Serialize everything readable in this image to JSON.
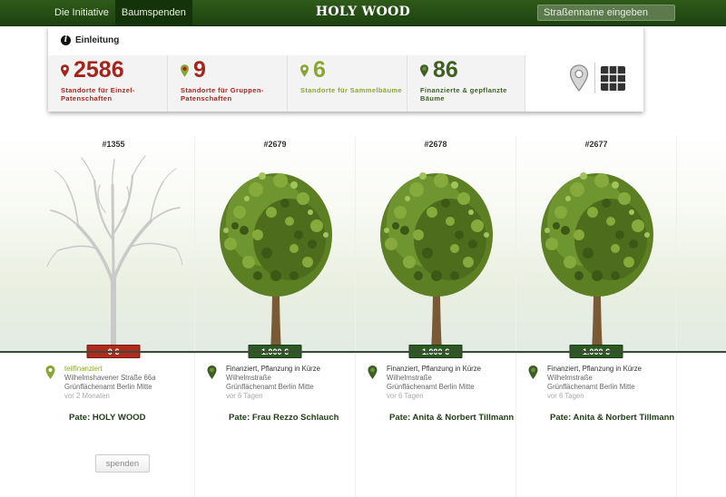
{
  "nav": {
    "items": [
      "Die Initiative",
      "Baumspenden"
    ],
    "active": 1
  },
  "logo": "HOLY WOOD",
  "search": {
    "placeholder": "Straßenname eingeben",
    "value": ""
  },
  "intro": {
    "title": "Einleitung",
    "stats": [
      {
        "value": "2586",
        "label": "Standorte für Einzel-Patenschaften",
        "color": "#a3261d"
      },
      {
        "value": "9",
        "label": "Standorte für Gruppen-Patenschaften",
        "color": "#a3261d"
      },
      {
        "value": "6",
        "label": "Standorte für Sammelbäume",
        "color": "#8aa632"
      },
      {
        "value": "86",
        "label": "Finanzierte & gepflanzte Bäume",
        "color": "#3e5e24"
      }
    ],
    "view_icons": [
      "map-pin-icon",
      "grid-icon"
    ]
  },
  "trees": [
    {
      "id": "#1355",
      "amount": "0 €",
      "status": "teilfinanziert",
      "street": "Wilhelmshavener Straße 66a",
      "office": "Grünflächenamt Berlin Mitte",
      "ago": "vor 2 Monaten",
      "pate": "Pate: HOLY WOOD",
      "state": "bare",
      "spend_label": "spenden"
    },
    {
      "id": "#2679",
      "amount": "1.000 €",
      "status": "Finanziert, Pflanzung in Kürze",
      "street": "Wilhelmstraße",
      "office": "Grünflächenamt Berlin Mitte",
      "ago": "vor 6 Tagen",
      "pate": "Pate: Frau Rezzo Schlauch",
      "state": "leafy"
    },
    {
      "id": "#2678",
      "amount": "1.000 €",
      "status": "Finanziert, Pflanzung in Kürze",
      "street": "Wilhelmstraße",
      "office": "Grünflächenamt Berlin Mitte",
      "ago": "vor 6 Tagen",
      "pate": "Pate: Anita & Norbert Tillmann",
      "state": "leafy"
    },
    {
      "id": "#2677",
      "amount": "1.000 €",
      "status": "Finanziert, Pflanzung in Kürze",
      "street": "Wilhelmstraße",
      "office": "Grünflächenamt Berlin Mitte",
      "ago": "vor 6 Tagen",
      "pate": "Pate: Anita & Norbert Tillmann",
      "state": "leafy"
    }
  ],
  "colors": {
    "topbar": "#2a5217",
    "red": "#b02a1d",
    "green": "#2c5a22",
    "lime": "#8aa632"
  }
}
